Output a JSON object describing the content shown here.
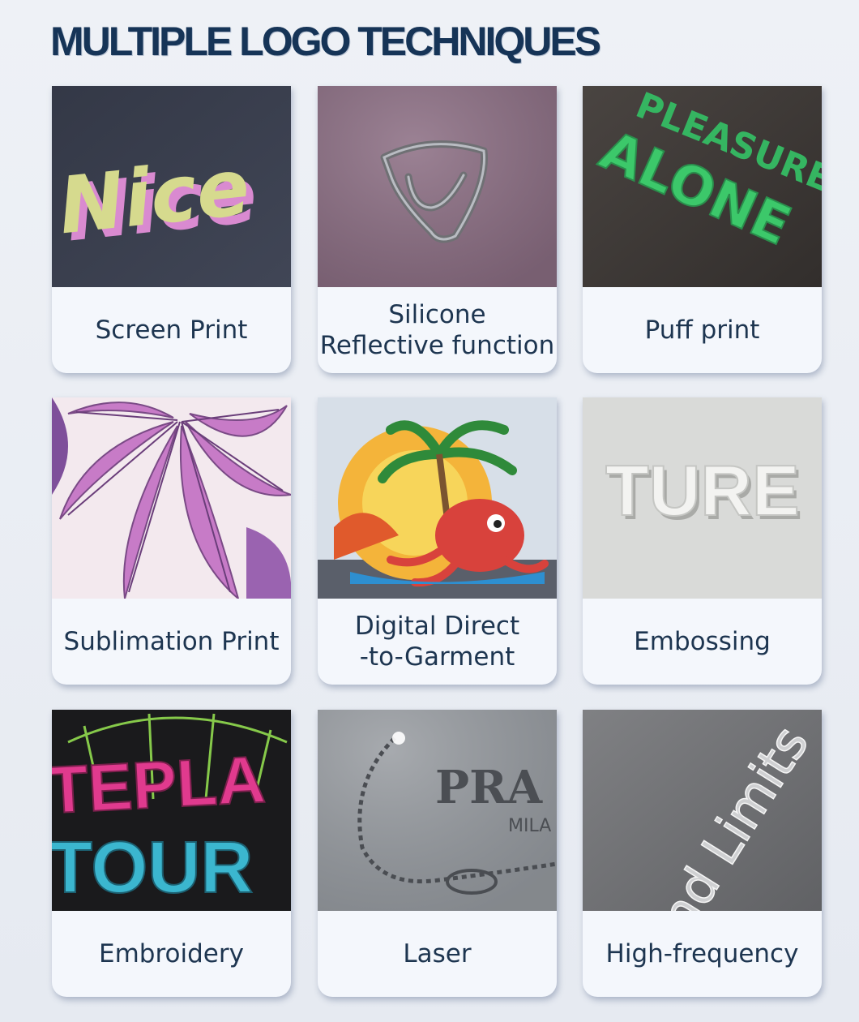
{
  "title": "MULTIPLE LOGO TECHNIQUES",
  "cards": [
    {
      "label": "Screen Print",
      "photo_text": "Nice"
    },
    {
      "label": "Silicone\nReflective function"
    },
    {
      "label": "Puff print",
      "photo_text": [
        "PLEASURE",
        "ALONE"
      ]
    },
    {
      "label": "Sublimation Print"
    },
    {
      "label": "Digital Direct\n-to-Garment"
    },
    {
      "label": "Embossing",
      "photo_text": "TURE"
    },
    {
      "label": "Embroidery",
      "photo_text": [
        "TEPLA",
        "TOUR"
      ]
    },
    {
      "label": "Laser",
      "photo_text": [
        "PRA",
        "MILA"
      ]
    },
    {
      "label": "High-frequency",
      "photo_text": "and Limits"
    }
  ]
}
